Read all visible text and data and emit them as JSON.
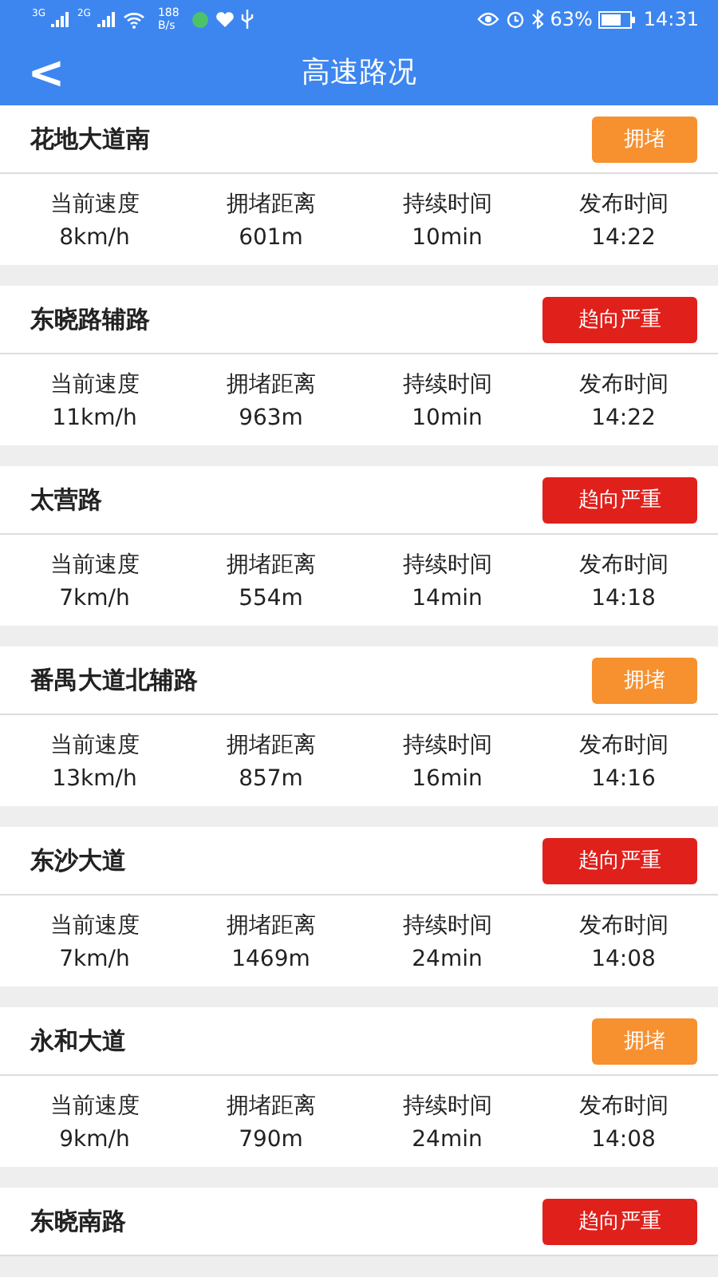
{
  "status_bar": {
    "sim1": "3G",
    "sim2": "2G",
    "speed": "188",
    "speed_unit": "B/s",
    "battery": "63%",
    "time": "14:31"
  },
  "header": {
    "back": "<",
    "title": "高速路况"
  },
  "roads": [
    {
      "name": "花地大道南",
      "status": "拥堵",
      "kind": "congested",
      "stats": [
        {
          "label": "当前速度",
          "value": "8km/h"
        },
        {
          "label": "拥堵距离",
          "value": "601m"
        },
        {
          "label": "持续时间",
          "value": "10min"
        },
        {
          "label": "发布时间",
          "value": "14:22"
        }
      ]
    },
    {
      "name": "东晓路辅路",
      "status": "趋向严重",
      "kind": "severe",
      "stats": [
        {
          "label": "当前速度",
          "value": "11km/h"
        },
        {
          "label": "拥堵距离",
          "value": "963m"
        },
        {
          "label": "持续时间",
          "value": "10min"
        },
        {
          "label": "发布时间",
          "value": "14:22"
        }
      ]
    },
    {
      "name": "太营路",
      "status": "趋向严重",
      "kind": "severe",
      "stats": [
        {
          "label": "当前速度",
          "value": "7km/h"
        },
        {
          "label": "拥堵距离",
          "value": "554m"
        },
        {
          "label": "持续时间",
          "value": "14min"
        },
        {
          "label": "发布时间",
          "value": "14:18"
        }
      ]
    },
    {
      "name": "番禺大道北辅路",
      "status": "拥堵",
      "kind": "congested",
      "stats": [
        {
          "label": "当前速度",
          "value": "13km/h"
        },
        {
          "label": "拥堵距离",
          "value": "857m"
        },
        {
          "label": "持续时间",
          "value": "16min"
        },
        {
          "label": "发布时间",
          "value": "14:16"
        }
      ]
    },
    {
      "name": "东沙大道",
      "status": "趋向严重",
      "kind": "severe",
      "stats": [
        {
          "label": "当前速度",
          "value": "7km/h"
        },
        {
          "label": "拥堵距离",
          "value": "1469m"
        },
        {
          "label": "持续时间",
          "value": "24min"
        },
        {
          "label": "发布时间",
          "value": "14:08"
        }
      ]
    },
    {
      "name": "永和大道",
      "status": "拥堵",
      "kind": "congested",
      "stats": [
        {
          "label": "当前速度",
          "value": "9km/h"
        },
        {
          "label": "拥堵距离",
          "value": "790m"
        },
        {
          "label": "持续时间",
          "value": "24min"
        },
        {
          "label": "发布时间",
          "value": "14:08"
        }
      ]
    },
    {
      "name": "东晓南路",
      "status": "趋向严重",
      "kind": "severe"
    }
  ]
}
